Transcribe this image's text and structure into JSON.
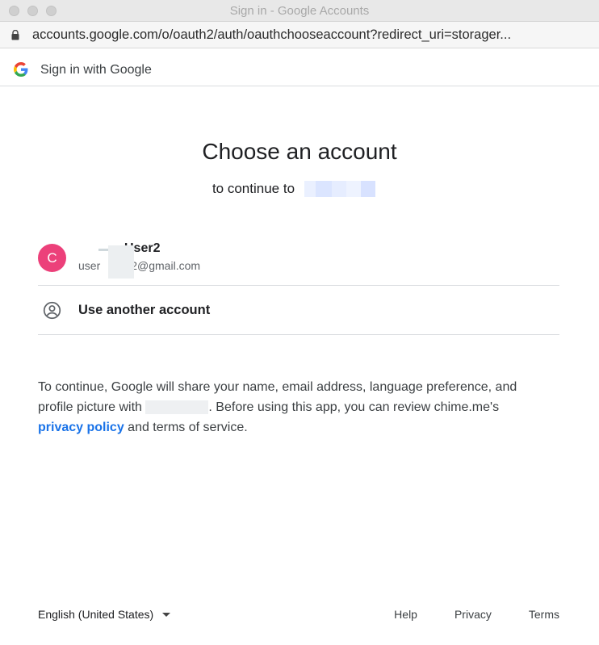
{
  "window": {
    "title": "Sign in - Google Accounts"
  },
  "urlbar": {
    "url": "accounts.google.com/o/oauth2/auth/oauthchooseaccount?redirect_uri=storager..."
  },
  "header": {
    "text": "Sign in with Google"
  },
  "main": {
    "headline": "Choose an account",
    "subhead_prefix": "to continue to"
  },
  "accounts": [
    {
      "initial": "C",
      "name": "User2",
      "email_prefix": "user",
      "email_suffix": "2@gmail.com",
      "avatar_color": "#ec407a"
    }
  ],
  "another_account": {
    "label": "Use another account"
  },
  "disclosure": {
    "line1": "To continue, Google will share your name, email address, language preference, and",
    "line2a": "profile picture with",
    "line2b": ". Before using this app, you can review chime.me's",
    "link_privacy": "privacy policy",
    "line3b": " and terms of service."
  },
  "footer": {
    "language": "English (United States)",
    "links": [
      "Help",
      "Privacy",
      "Terms"
    ]
  },
  "colors": {
    "link": "#1a73e8",
    "divider": "#dadce0"
  },
  "icons": {
    "lock": "lock-icon",
    "google": "google-logo-icon",
    "person": "account-circle-icon",
    "dropdown": "caret-down-icon"
  }
}
